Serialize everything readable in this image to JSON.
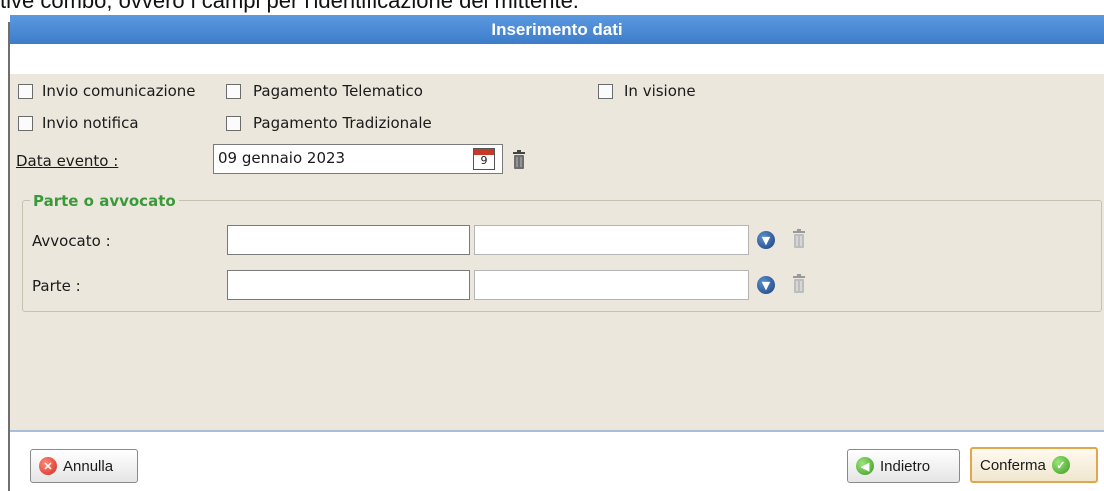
{
  "background_text": "tive combo, ovvero i campi per l'identificazione del mittente.",
  "window": {
    "title": "Inserimento dati"
  },
  "options": {
    "invio_comunicazione": "Invio comunicazione",
    "pagamento_telematico": "Pagamento Telematico",
    "in_visione": "In visione",
    "invio_notifica": "Invio notifica",
    "pagamento_tradizionale": "Pagamento Tradizionale"
  },
  "data_evento": {
    "label": "Data evento :",
    "value": "09 gennaio 2023",
    "calendar_day": "9"
  },
  "parte_group": {
    "legend": "Parte o avvocato",
    "avvocato_label": "Avvocato :",
    "parte_label": "Parte :",
    "avvocato_code": "",
    "avvocato_name": "",
    "parte_code": "",
    "parte_name": ""
  },
  "buttons": {
    "annulla": "Annulla",
    "indietro": "Indietro",
    "conferma": "Conferma"
  },
  "colors": {
    "title_bar": "#4a8ad6",
    "panel": "#ebe7dc",
    "legend": "#3a9a3a"
  }
}
